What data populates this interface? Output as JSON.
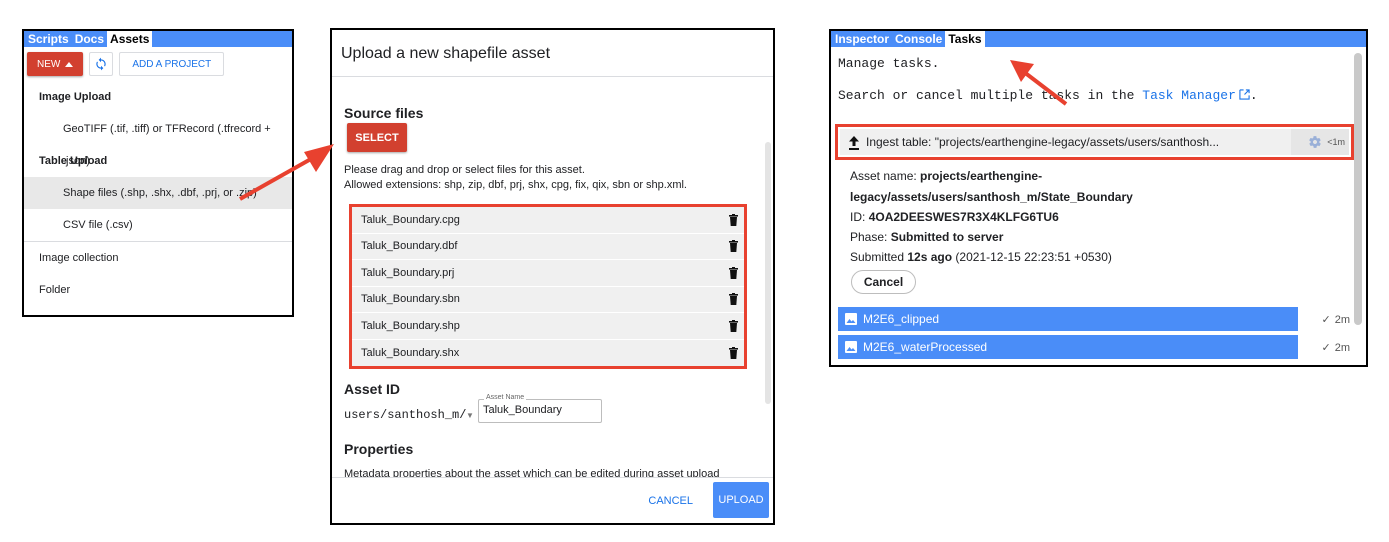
{
  "assets_panel": {
    "tabs": [
      {
        "label": "Scripts",
        "active": false
      },
      {
        "label": "Docs",
        "active": false
      },
      {
        "label": "Assets",
        "active": true
      }
    ],
    "new_button": "NEW",
    "refresh_icon": "refresh-icon",
    "add_project": "ADD A PROJECT",
    "image_upload_heading": "Image Upload",
    "image_upload_item": "GeoTIFF (.tif, .tiff) or TFRecord (.tfrecord + .json)",
    "table_upload_heading": "Table Upload",
    "shape_files_item": "Shape files (.shp, .shx, .dbf, .prj, or .zip)",
    "csv_item": "CSV file (.csv)",
    "image_collection": "Image collection",
    "folder": "Folder"
  },
  "upload_dialog": {
    "title": "Upload a new shapefile asset",
    "source_files_heading": "Source files",
    "select_button": "SELECT",
    "help_line1": "Please drag and drop or select files for this asset.",
    "help_line2": "Allowed extensions: shp, zip, dbf, prj, shx, cpg, fix, qix, sbn or shp.xml.",
    "files": [
      "Taluk_Boundary.cpg",
      "Taluk_Boundary.dbf",
      "Taluk_Boundary.prj",
      "Taluk_Boundary.sbn",
      "Taluk_Boundary.shp",
      "Taluk_Boundary.shx"
    ],
    "asset_id_heading": "Asset ID",
    "asset_prefix": "users/santhosh_m/",
    "asset_name_label": "Asset Name",
    "asset_name_value": "Taluk_Boundary",
    "properties_heading": "Properties",
    "properties_desc": "Metadata properties about the asset which can be edited during asset upload",
    "cancel_button": "CANCEL",
    "upload_button": "UPLOAD"
  },
  "tasks_panel": {
    "tabs": [
      {
        "label": "Inspector",
        "active": false
      },
      {
        "label": "Console",
        "active": false
      },
      {
        "label": "Tasks",
        "active": true
      }
    ],
    "manage_text": "Manage tasks.",
    "search_prefix": "Search or cancel multiple tasks in the",
    "task_manager_link": "Task Manager",
    "search_suffix": ".",
    "task": {
      "title": "Ingest table: \"projects/earthengine-legacy/assets/users/santhosh...",
      "elapsed": "<1m",
      "asset_name_label": "Asset name:",
      "asset_name_line1": "projects/earthengine-",
      "asset_name_line2": "legacy/assets/users/santhosh_m/State_Boundary",
      "id_label": "ID:",
      "id_value": "4OA2DEESWES7R3X4KLFG6TU6",
      "phase_label": "Phase:",
      "phase_value": "Submitted to server",
      "submitted_label": "Submitted",
      "submitted_ago": "12s ago",
      "submitted_time": "(2021-12-15 22:23:51 +0530)",
      "cancel_button": "Cancel"
    },
    "completed": [
      {
        "name": "M2E6_clipped",
        "duration": "2m"
      },
      {
        "name": "M2E6_waterProcessed",
        "duration": "2m"
      }
    ]
  },
  "colors": {
    "accent_red": "#d2402f",
    "highlight_red": "#e8412f",
    "tab_blue": "#4a8df8",
    "link_blue": "#1a73e8"
  }
}
